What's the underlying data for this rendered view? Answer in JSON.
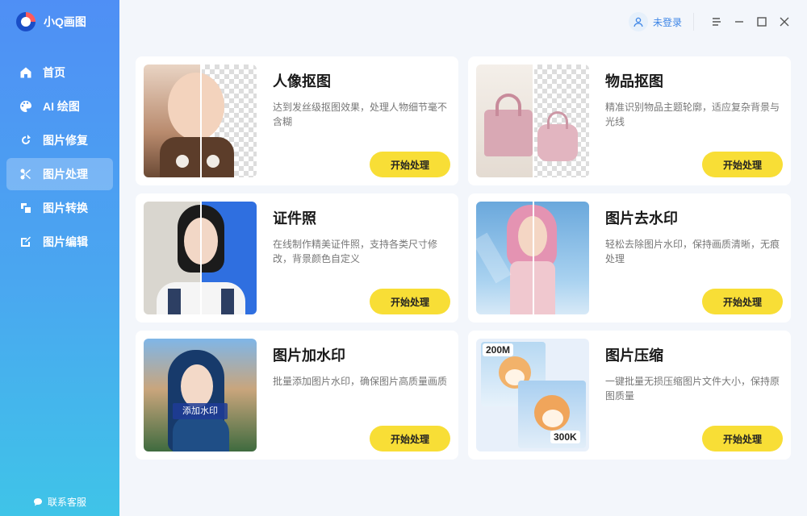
{
  "app": {
    "name": "小Q画图"
  },
  "sidebar": {
    "items": [
      {
        "label": "首页",
        "icon": "home-icon"
      },
      {
        "label": "AI 绘图",
        "icon": "palette-icon"
      },
      {
        "label": "图片修复",
        "icon": "repair-icon"
      },
      {
        "label": "图片处理",
        "icon": "scissors-icon",
        "active": true
      },
      {
        "label": "图片转换",
        "icon": "convert-icon"
      },
      {
        "label": "图片编辑",
        "icon": "edit-icon"
      }
    ],
    "support": {
      "label": "联系客服",
      "icon": "chat-icon"
    }
  },
  "topbar": {
    "user_label": "未登录",
    "buttons": [
      "menu-icon",
      "minimize-icon",
      "maximize-icon",
      "close-icon"
    ]
  },
  "cards": [
    {
      "title": "人像抠图",
      "desc": "达到发丝级抠图效果，处理人物细节毫不含糊",
      "button": "开始处理"
    },
    {
      "title": "物品抠图",
      "desc": "精准识别物品主题轮廓，适应复杂背景与光线",
      "button": "开始处理"
    },
    {
      "title": "证件照",
      "desc": "在线制作精美证件照，支持各类尺寸修改，背景颜色自定义",
      "button": "开始处理"
    },
    {
      "title": "图片去水印",
      "desc": "轻松去除图片水印，保持画质清晰，无痕处理",
      "button": "开始处理"
    },
    {
      "title": "图片加水印",
      "desc": "批量添加图片水印，确保图片高质量画质",
      "button": "开始处理",
      "thumb_label": "添加水印"
    },
    {
      "title": "图片压缩",
      "desc": "一键批量无损压缩图片文件大小，保持原图质量",
      "button": "开始处理",
      "size_before": "200M",
      "size_after": "300K"
    }
  ],
  "colors": {
    "accent": "#4f8ff5",
    "button": "#f8de36",
    "user_text": "#3d85e6"
  }
}
